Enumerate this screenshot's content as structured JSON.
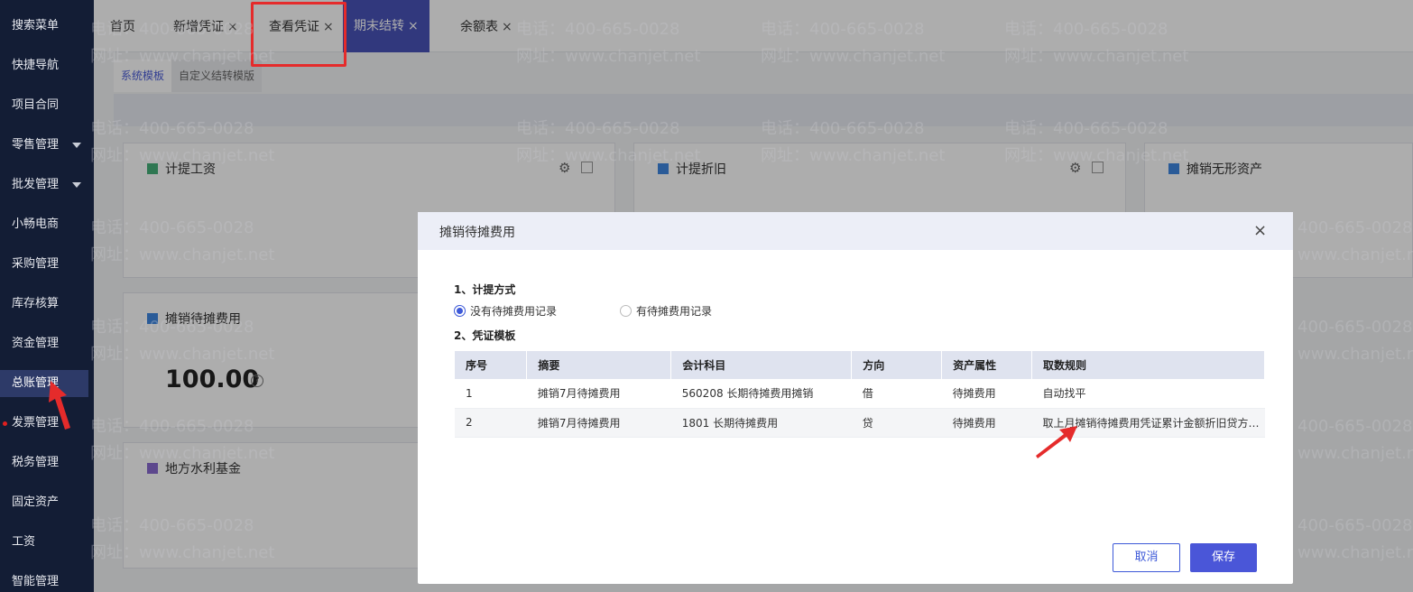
{
  "sidebar": {
    "items": [
      {
        "label": "搜索菜单"
      },
      {
        "label": "快捷导航"
      },
      {
        "label": "项目合同"
      },
      {
        "label": "零售管理"
      },
      {
        "label": "批发管理"
      },
      {
        "label": "小畅电商"
      },
      {
        "label": "采购管理"
      },
      {
        "label": "库存核算"
      },
      {
        "label": "资金管理"
      },
      {
        "label": "总账管理"
      },
      {
        "label": "发票管理"
      },
      {
        "label": "税务管理"
      },
      {
        "label": "固定资产"
      },
      {
        "label": "工资"
      },
      {
        "label": "智能管理"
      }
    ]
  },
  "tabs": [
    {
      "label": "首页"
    },
    {
      "label": "新增凭证"
    },
    {
      "label": "查看凭证"
    },
    {
      "label": "期末结转"
    },
    {
      "label": "余额表"
    }
  ],
  "close_glyph": "×",
  "subtabs": {
    "system": "系统模板",
    "custom": "自定义结转模版"
  },
  "cards": {
    "salary": {
      "title": "计提工资"
    },
    "depreciation": {
      "title": "计提折旧"
    },
    "intangible": {
      "title": "摊销无形资产"
    },
    "prepaid": {
      "title": "摊销待摊费用",
      "amount": "100.00",
      "help": "?"
    },
    "water": {
      "title": "地方水利基金"
    }
  },
  "icons": {
    "gear": "⚙",
    "help": "?"
  },
  "watermark": {
    "phone": "电话：400-665-0028",
    "site": "网址：www.chanjet.net"
  },
  "dialog": {
    "title": "摊销待摊费用",
    "close": "×",
    "section1": "1、计提方式",
    "radio_a": "没有待摊费用记录",
    "radio_b": "有待摊费用记录",
    "section2": "2、凭证模板",
    "columns": [
      "序号",
      "摘要",
      "会计科目",
      "方向",
      "资产属性",
      "取数规则"
    ],
    "rows": [
      [
        "1",
        "摊销7月待摊费用",
        "560208 长期待摊费用摊销",
        "借",
        "待摊费用",
        "自动找平"
      ],
      [
        "2",
        "摊销7月待摊费用",
        "1801 长期待摊费用",
        "贷",
        "待摊费用",
        "取上月摊销待摊费用凭证累计金额折旧贷方…"
      ]
    ],
    "cancel": "取消",
    "save": "保存"
  },
  "colors": {
    "accent": "#4953b8",
    "sidebar": "#131d35",
    "highlight": "#e52b2b"
  }
}
